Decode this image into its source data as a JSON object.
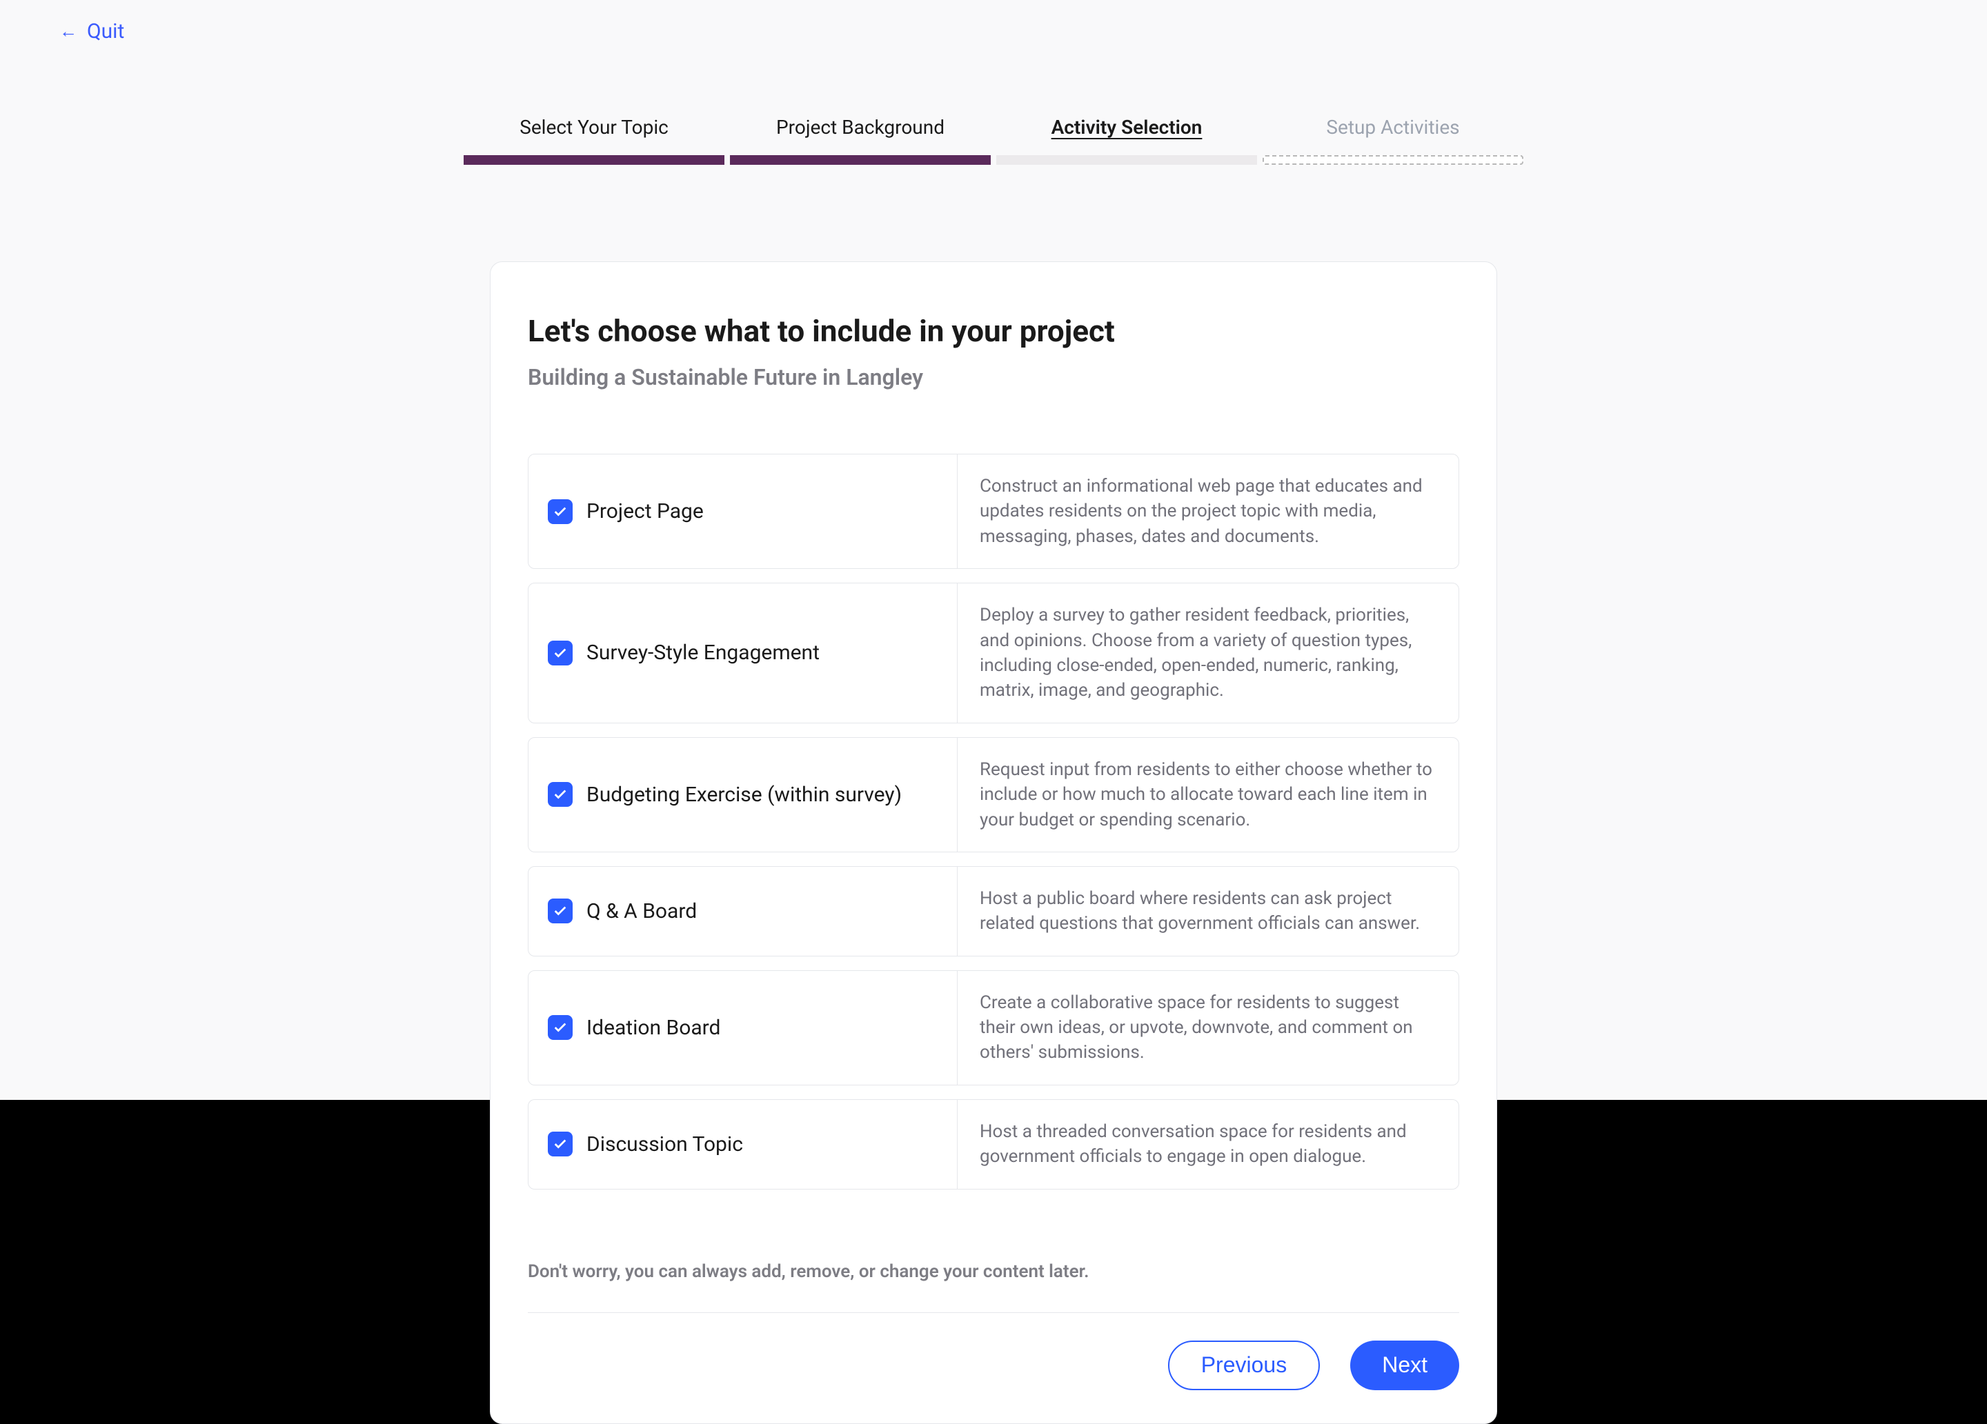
{
  "quit": {
    "label": "Quit"
  },
  "stepper": {
    "steps": [
      {
        "label": "Select Your Topic",
        "state": "filled"
      },
      {
        "label": "Project Background",
        "state": "filled"
      },
      {
        "label": "Activity Selection",
        "state": "active"
      },
      {
        "label": "Setup Activities",
        "state": "dashed"
      }
    ]
  },
  "card": {
    "title": "Let's choose what to include in your project",
    "subtitle": "Building a Sustainable Future in Langley",
    "helper": "Don't worry, you can always add, remove, or change your content later.",
    "options": [
      {
        "label": "Project Page",
        "checked": true,
        "description": "Construct an informational web page that educates and updates residents on the project topic with media, messaging, phases, dates and documents."
      },
      {
        "label": "Survey-Style Engagement",
        "checked": true,
        "description": "Deploy a survey to gather resident feedback, priorities, and opinions. Choose from a variety of question types, including close-ended, open-ended, numeric, ranking, matrix, image, and geographic."
      },
      {
        "label": "Budgeting Exercise (within survey)",
        "checked": true,
        "description": "Request input from residents to either choose whether to include or how much to allocate toward each line item in your budget or spending scenario."
      },
      {
        "label": "Q & A Board",
        "checked": true,
        "description": "Host a public board where residents can ask project related questions that government officials can answer."
      },
      {
        "label": "Ideation Board",
        "checked": true,
        "description": "Create a collaborative space for residents to suggest their own ideas, or upvote, downvote, and comment on others' submissions."
      },
      {
        "label": "Discussion Topic",
        "checked": true,
        "description": "Host a threaded conversation space for residents and government officials to engage in open dialogue."
      }
    ]
  },
  "actions": {
    "previous": "Previous",
    "next": "Next"
  }
}
